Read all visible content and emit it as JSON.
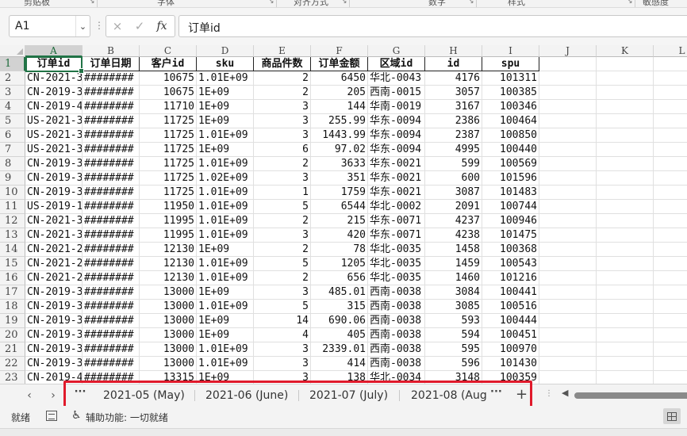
{
  "ribbon": {
    "groups": [
      "剪贴板",
      "字体",
      "对齐方式",
      "数字",
      "样式",
      "敏感度"
    ]
  },
  "formula_bar": {
    "name_box": "A1",
    "cancel_icon": "×",
    "enter_icon": "✓",
    "fx_label": "fx",
    "formula": "订单id"
  },
  "columns": [
    "A",
    "B",
    "C",
    "D",
    "E",
    "F",
    "G",
    "H",
    "I",
    "J",
    "K",
    "L"
  ],
  "rows": [
    "1",
    "2",
    "3",
    "4",
    "5",
    "6",
    "7",
    "8",
    "9",
    "10",
    "11",
    "12",
    "13",
    "14",
    "15",
    "16",
    "17",
    "18",
    "19",
    "20",
    "21",
    "22",
    "23"
  ],
  "headers": [
    "订单id",
    "订单日期",
    "客户id",
    "sku",
    "商品件数",
    "订单金额",
    "区域id",
    "id",
    "spu"
  ],
  "table": [
    [
      "CN-2021-3",
      "########",
      "10675",
      "1.01E+09",
      "2",
      "6450",
      "华北-0043",
      "4176",
      "101311"
    ],
    [
      "CN-2019-3",
      "########",
      "10675",
      "1E+09",
      "2",
      "205",
      "西南-0015",
      "3057",
      "100385"
    ],
    [
      "CN-2019-4",
      "########",
      "11710",
      "1E+09",
      "3",
      "144",
      "华南-0019",
      "3167",
      "100346"
    ],
    [
      "US-2021-3",
      "########",
      "11725",
      "1E+09",
      "3",
      "255.99",
      "华东-0094",
      "2386",
      "100464"
    ],
    [
      "US-2021-3",
      "########",
      "11725",
      "1.01E+09",
      "3",
      "1443.99",
      "华东-0094",
      "2387",
      "100850"
    ],
    [
      "US-2021-3",
      "########",
      "11725",
      "1E+09",
      "6",
      "97.02",
      "华东-0094",
      "4995",
      "100440"
    ],
    [
      "CN-2019-3",
      "########",
      "11725",
      "1.01E+09",
      "2",
      "3633",
      "华东-0021",
      "599",
      "100569"
    ],
    [
      "CN-2019-3",
      "########",
      "11725",
      "1.02E+09",
      "3",
      "351",
      "华东-0021",
      "600",
      "101596"
    ],
    [
      "CN-2019-3",
      "########",
      "11725",
      "1.01E+09",
      "1",
      "1759",
      "华东-0021",
      "3087",
      "101483"
    ],
    [
      "US-2019-1",
      "########",
      "11950",
      "1.01E+09",
      "5",
      "6544",
      "华北-0002",
      "2091",
      "100744"
    ],
    [
      "CN-2021-3",
      "########",
      "11995",
      "1.01E+09",
      "2",
      "215",
      "华东-0071",
      "4237",
      "100946"
    ],
    [
      "CN-2021-3",
      "########",
      "11995",
      "1.01E+09",
      "3",
      "420",
      "华东-0071",
      "4238",
      "101475"
    ],
    [
      "CN-2021-2",
      "########",
      "12130",
      "1E+09",
      "2",
      "78",
      "华北-0035",
      "1458",
      "100368"
    ],
    [
      "CN-2021-2",
      "########",
      "12130",
      "1.01E+09",
      "5",
      "1205",
      "华北-0035",
      "1459",
      "100543"
    ],
    [
      "CN-2021-2",
      "########",
      "12130",
      "1.01E+09",
      "2",
      "656",
      "华北-0035",
      "1460",
      "101216"
    ],
    [
      "CN-2019-3",
      "########",
      "13000",
      "1E+09",
      "3",
      "485.01",
      "西南-0038",
      "3084",
      "100441"
    ],
    [
      "CN-2019-3",
      "########",
      "13000",
      "1.01E+09",
      "5",
      "315",
      "西南-0038",
      "3085",
      "100516"
    ],
    [
      "CN-2019-3",
      "########",
      "13000",
      "1E+09",
      "14",
      "690.06",
      "西南-0038",
      "593",
      "100444"
    ],
    [
      "CN-2019-3",
      "########",
      "13000",
      "1E+09",
      "4",
      "405",
      "西南-0038",
      "594",
      "100451"
    ],
    [
      "CN-2019-3",
      "########",
      "13000",
      "1.01E+09",
      "3",
      "2339.01",
      "西南-0038",
      "595",
      "100970"
    ],
    [
      "CN-2019-3",
      "########",
      "13000",
      "1.01E+09",
      "3",
      "414",
      "西南-0038",
      "596",
      "101430"
    ],
    [
      "CN-2019-4",
      "########",
      "13315",
      "1E+09",
      "3",
      "138",
      "华北-0034",
      "3148",
      "100359"
    ]
  ],
  "sheet_tabs": [
    "2021-05 (May)",
    "2021-06 (June)",
    "2021-07 (July)",
    "2021-08 (Aug"
  ],
  "sheet_nav": {
    "prev": "‹",
    "next": "›",
    "more": "···",
    "add": "+"
  },
  "status": {
    "ready": "就绪",
    "accessibility": "辅助功能: 一切就绪"
  },
  "colors": {
    "accent": "#217346",
    "highlight_box": "#e01a2b"
  }
}
